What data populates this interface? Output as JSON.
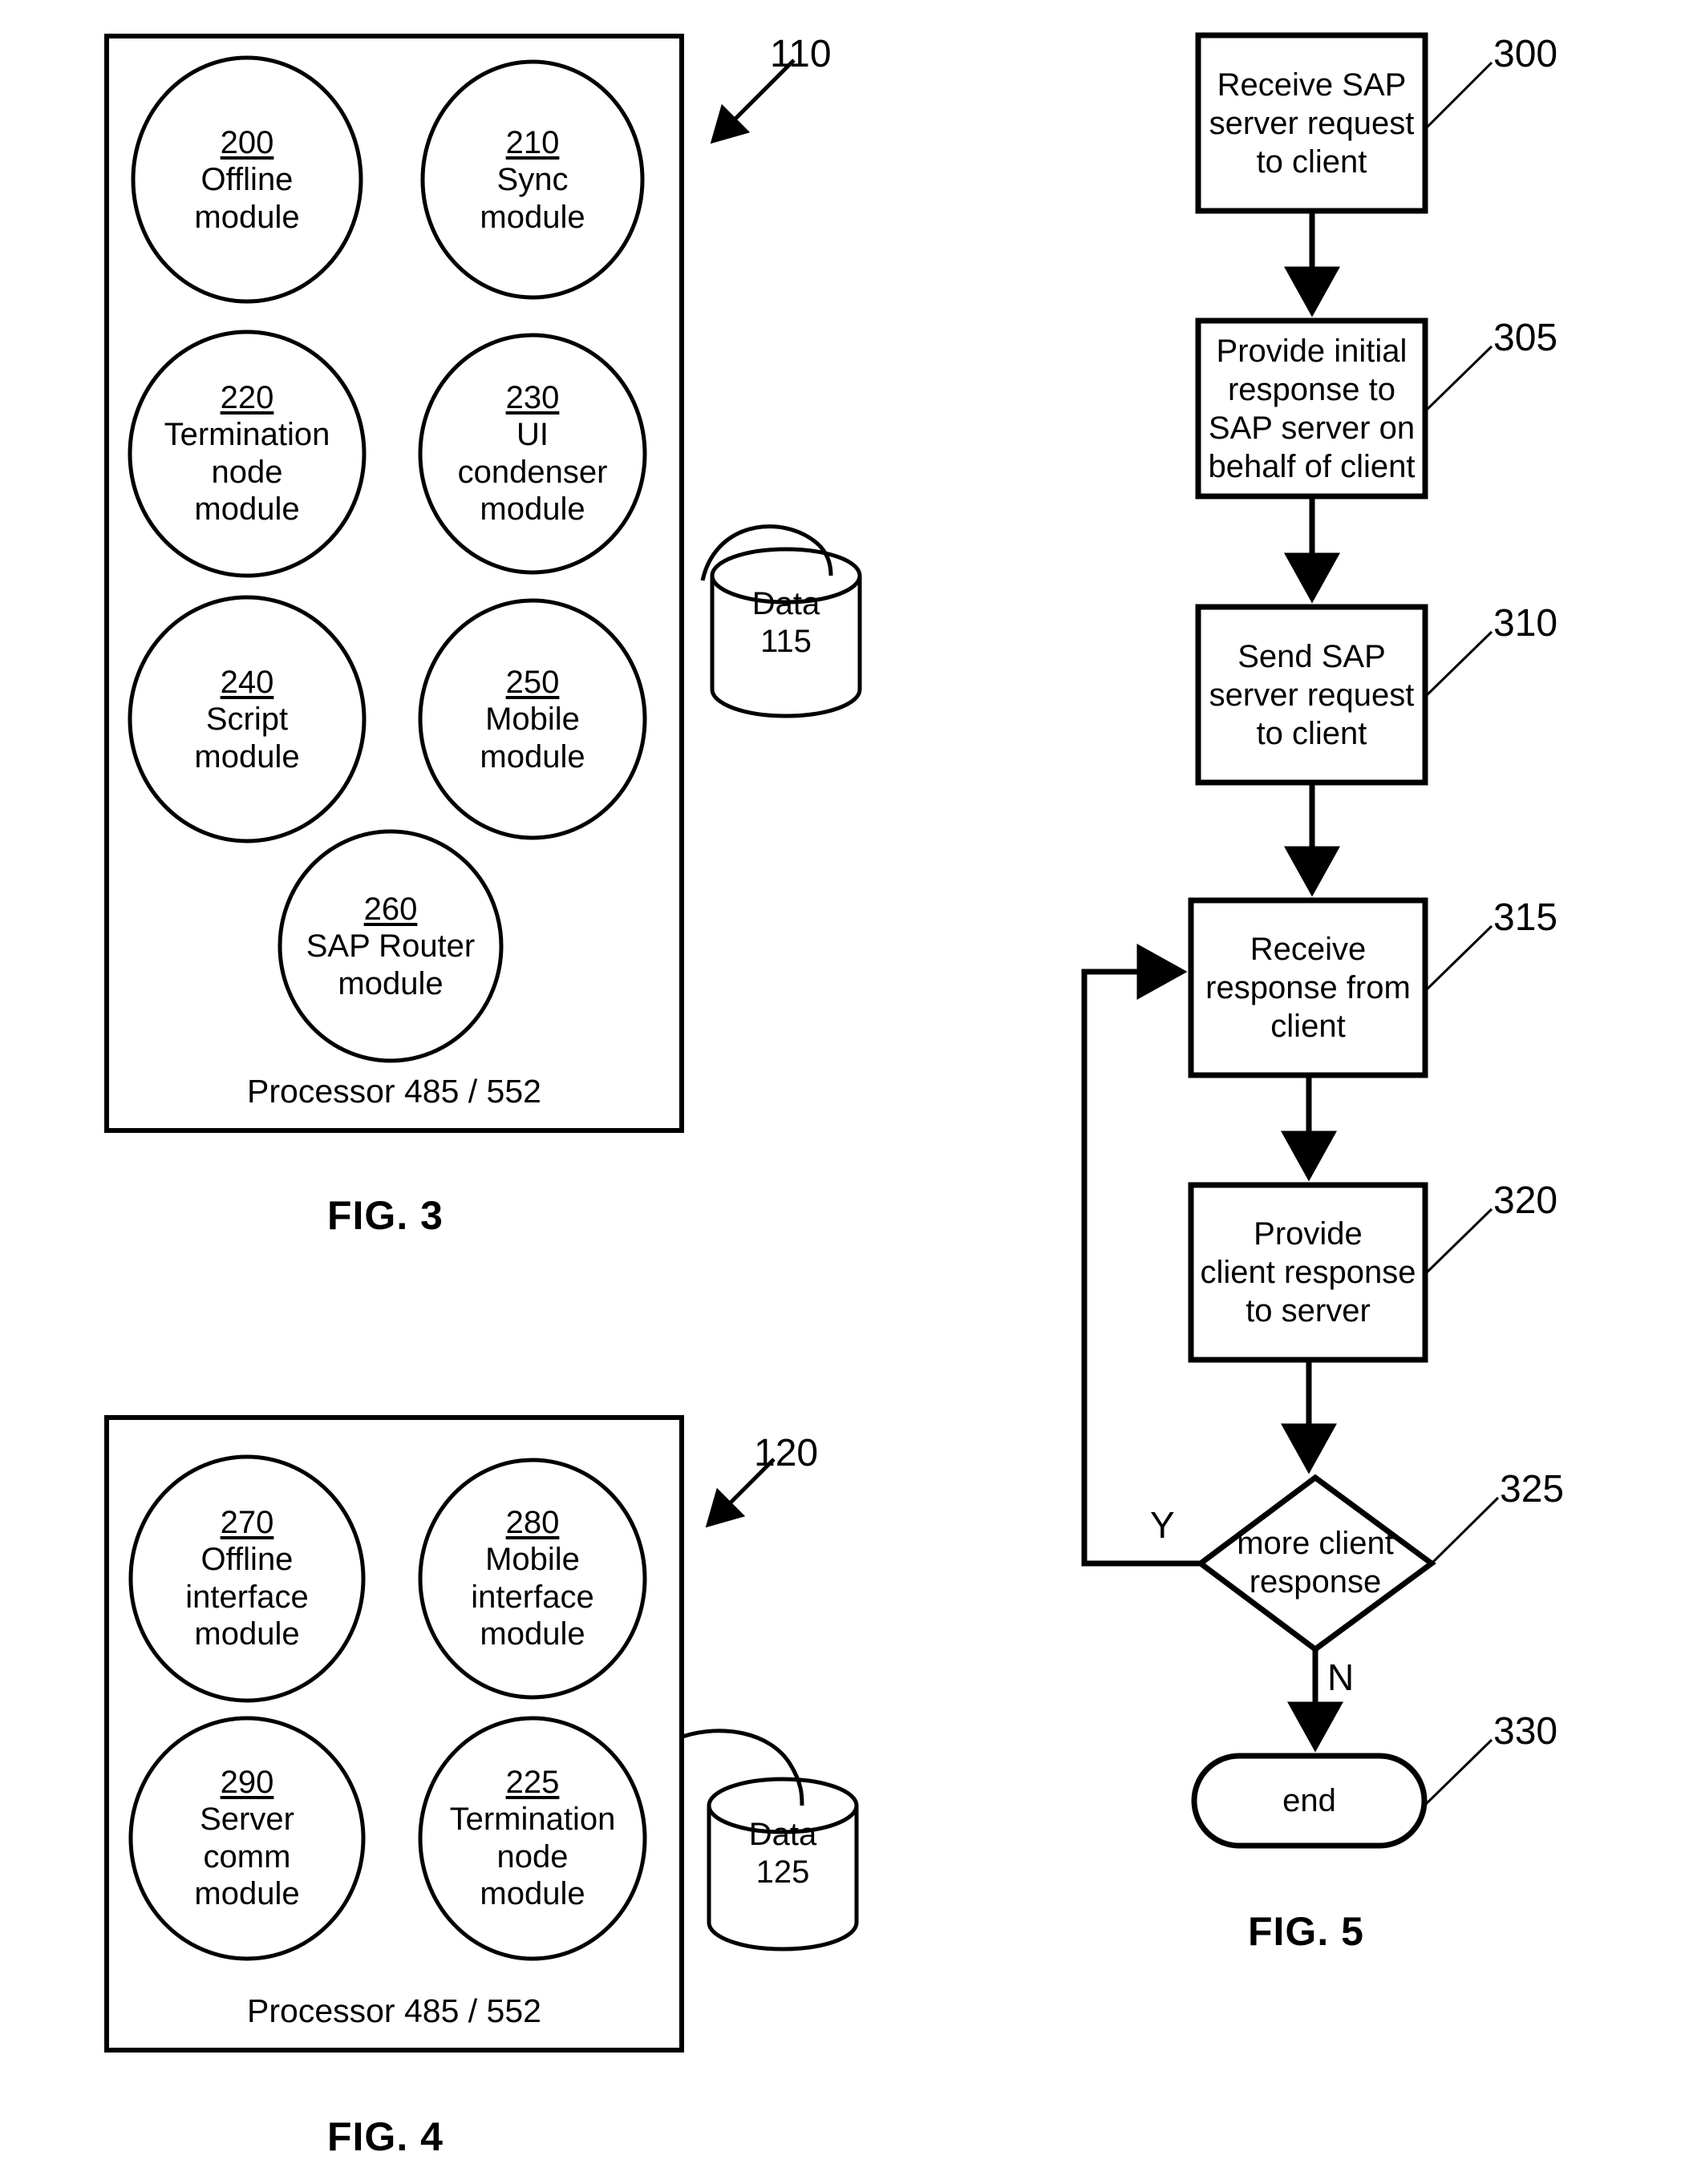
{
  "figures": [
    {
      "id": "fig3",
      "caption": "FIG. 3",
      "reference": "110",
      "processor_label": "Processor 485 / 552",
      "database": {
        "name": "Data",
        "number": "115"
      },
      "modules": [
        {
          "number": "200",
          "label": "Offline\nmodule"
        },
        {
          "number": "210",
          "label": "Sync\nmodule"
        },
        {
          "number": "220",
          "label": "Termination\nnode\nmodule"
        },
        {
          "number": "230",
          "label": "UI\ncondenser\nmodule"
        },
        {
          "number": "240",
          "label": "Script\nmodule"
        },
        {
          "number": "250",
          "label": "Mobile\nmodule"
        },
        {
          "number": "260",
          "label": "SAP Router\nmodule"
        }
      ]
    },
    {
      "id": "fig4",
      "caption": "FIG. 4",
      "reference": "120",
      "processor_label": "Processor 485 / 552",
      "database": {
        "name": "Data",
        "number": "125"
      },
      "modules": [
        {
          "number": "270",
          "label": "Offline\ninterface\nmodule"
        },
        {
          "number": "280",
          "label": "Mobile\ninterface\nmodule"
        },
        {
          "number": "290",
          "label": "Server\ncomm\nmodule"
        },
        {
          "number": "225",
          "label": "Termination\nnode\nmodule"
        }
      ]
    },
    {
      "id": "fig5",
      "caption": "FIG. 5",
      "steps": [
        {
          "number": "300",
          "label": "Receive SAP\nserver request\nto client",
          "shape": "process"
        },
        {
          "number": "305",
          "label": "Provide initial\nresponse to\nSAP server on\nbehalf of client",
          "shape": "process"
        },
        {
          "number": "310",
          "label": "Send SAP\nserver request\nto client",
          "shape": "process"
        },
        {
          "number": "315",
          "label": "Receive\nresponse from\nclient",
          "shape": "process"
        },
        {
          "number": "320",
          "label": "Provide\nclient response\nto server",
          "shape": "process"
        },
        {
          "number": "325",
          "label": "more client\nresponse",
          "shape": "decision"
        },
        {
          "number": "330",
          "label": "end",
          "shape": "terminator"
        }
      ],
      "branch_labels": {
        "yes": "Y",
        "no": "N"
      }
    }
  ],
  "colors": {
    "ink": "#000000",
    "paper": "#ffffff"
  }
}
